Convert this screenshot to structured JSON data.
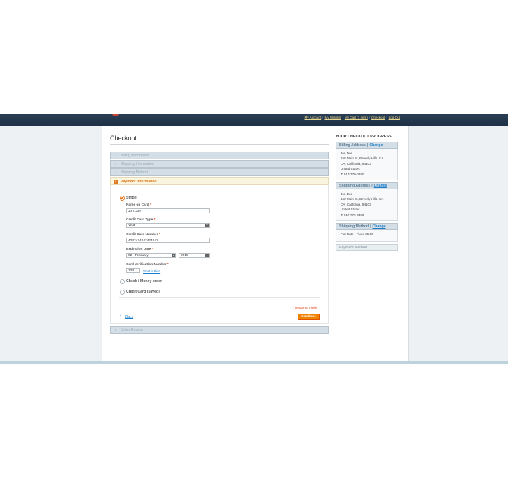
{
  "header": {
    "links": [
      "My Account",
      "My Wishlist",
      "My Cart (1 item)",
      "Checkout",
      "Log Out"
    ],
    "logo_color": "#c8473a"
  },
  "checkout": {
    "title": "Checkout",
    "steps": [
      {
        "num": "1",
        "label": "Billing Information"
      },
      {
        "num": "2",
        "label": "Shipping Information"
      },
      {
        "num": "3",
        "label": "Shipping Method"
      },
      {
        "num": "4",
        "label": "Payment Information"
      },
      {
        "num": "5",
        "label": "Order Review"
      }
    ],
    "payment": {
      "methods": [
        "Stripe",
        "Check / Money order",
        "Credit Card (saved)"
      ],
      "selected": "Stripe",
      "name_label": "Name on Card",
      "name_value": "Jon Doe",
      "type_label": "Credit Card Type",
      "type_value": "Visa",
      "number_label": "Credit Card Number",
      "number_value": "4242424242424242",
      "exp_label": "Expiration Date",
      "exp_month": "02 - February",
      "exp_year": "2015",
      "cvv_label": "Card Verification Number",
      "cvv_value": "123",
      "whats_this": "What is this?",
      "required_mark": "*"
    },
    "required_note": "* Required Fields",
    "back_label": "Back",
    "continue_label": "Continue",
    "accent_color": "#f18200"
  },
  "progress": {
    "title": "YOUR CHECKOUT PROGRESS",
    "change_label": "Change",
    "billing": {
      "title": "Billing Address",
      "lines": [
        "Jon Doe",
        "168 Main St, Beverly Hills, CA",
        "CA, California, 94103",
        "United States",
        "T: 917-779-0480"
      ]
    },
    "shipping": {
      "title": "Shipping Address",
      "lines": [
        "Jon Doe",
        "168 Main St, Beverly Hills, CA",
        "CA, California, 94103",
        "United States",
        "T: 917-779-0480"
      ]
    },
    "method": {
      "title": "Shipping Method",
      "value": "Flat Rate - Fixed $5.00"
    },
    "payment_title": "Payment Method"
  }
}
